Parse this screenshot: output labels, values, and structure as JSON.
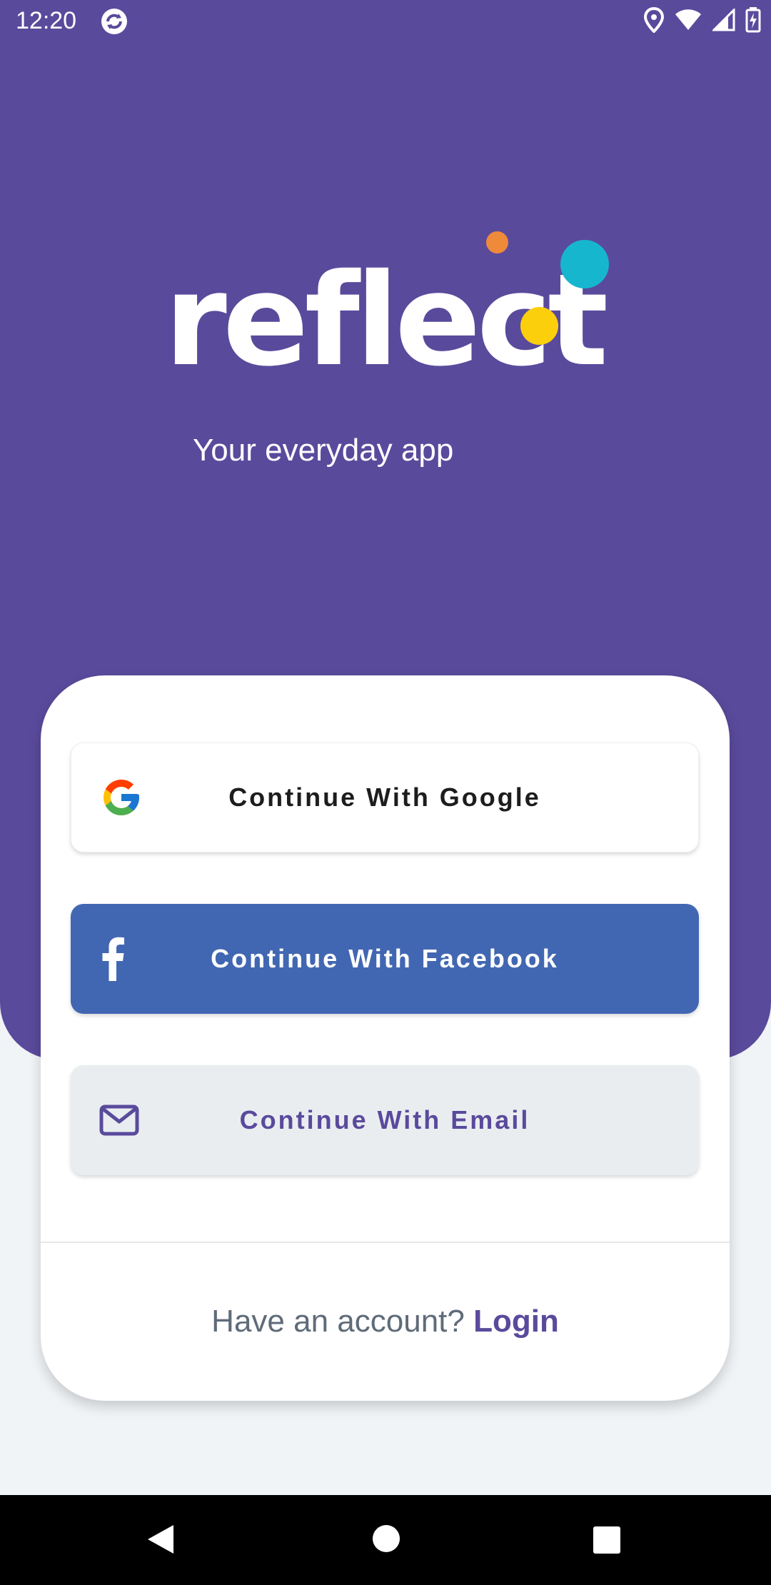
{
  "status_bar": {
    "time": "12:20",
    "icons": [
      "sync-icon",
      "location-icon",
      "wifi-icon",
      "signal-icon",
      "battery-charging-icon"
    ]
  },
  "brand": {
    "logo_text": "reflect",
    "tagline": "Your everyday app",
    "dot_colors": [
      "#ee8a3a",
      "#17b6cf",
      "#fccf0c"
    ]
  },
  "auth": {
    "google_label": "Continue With Google",
    "facebook_label": "Continue With Facebook",
    "email_label": "Continue With Email",
    "footer_prompt": "Have an account?",
    "login_label": "Login"
  },
  "colors": {
    "primary": "#5a4a9c",
    "facebook": "#4267b2",
    "email_bg": "#e9edf0",
    "page_bg": "#f1f4f7"
  },
  "nav": {
    "icons": [
      "back-icon",
      "home-icon",
      "recents-icon"
    ]
  }
}
